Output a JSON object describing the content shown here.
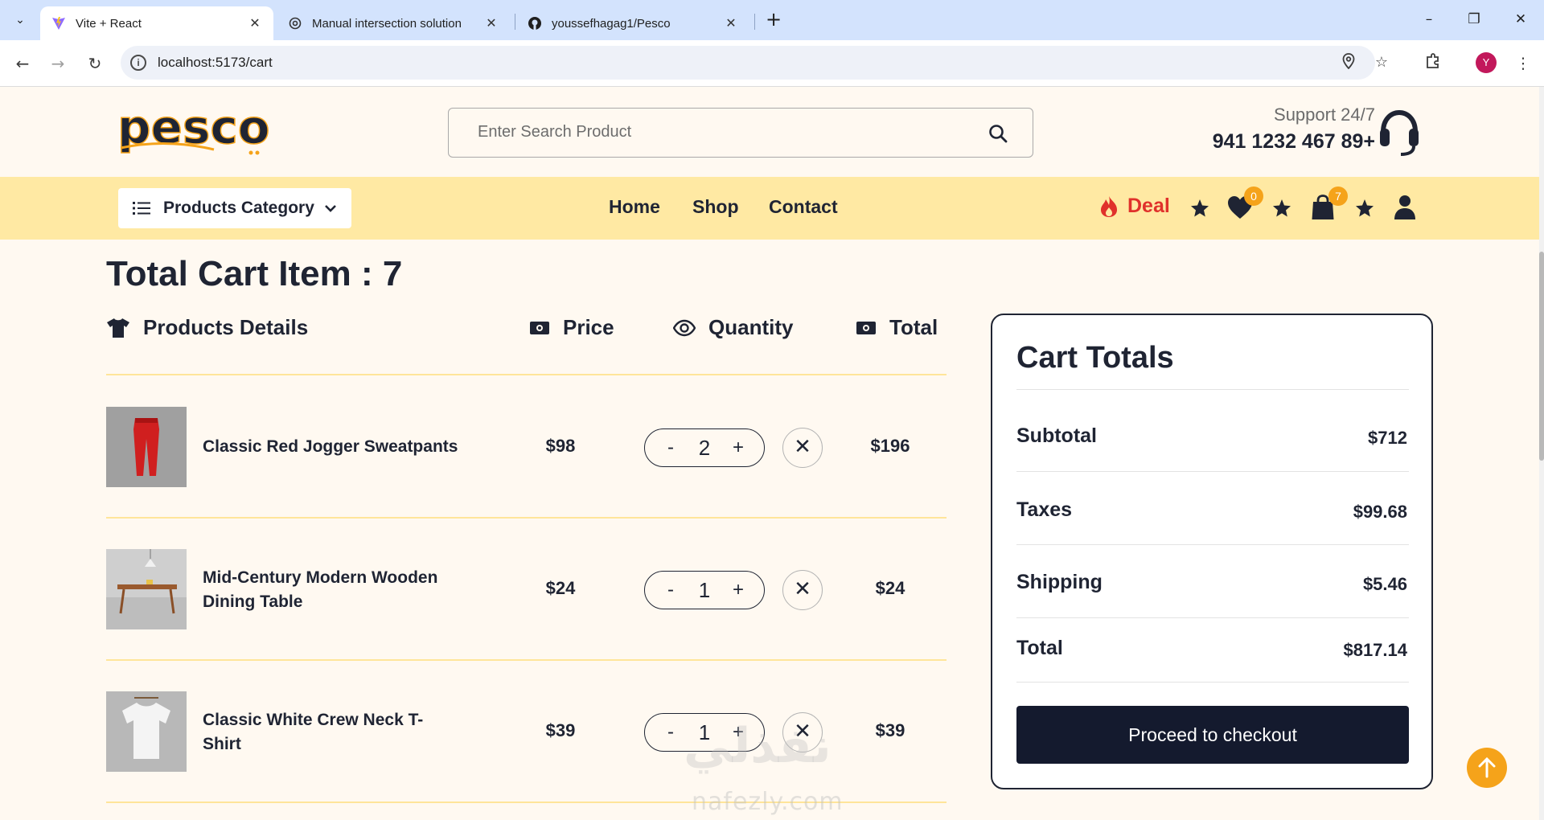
{
  "browser": {
    "tabs": [
      {
        "title": "Vite + React",
        "active": true
      },
      {
        "title": "Manual intersection solution",
        "active": false
      },
      {
        "title": "youssefhagag1/Pesco",
        "active": false
      }
    ],
    "url": "localhost:5173/cart",
    "profile_initial": "Y"
  },
  "header": {
    "logo_text": "pesco",
    "search_placeholder": "Enter Search Product",
    "support_label": "Support 24/7",
    "support_phone": "941 1232 467 89+"
  },
  "navbar": {
    "category_label": "Products Category",
    "links": [
      "Home",
      "Shop",
      "Contact"
    ],
    "deal_label": "Deal",
    "wishlist_count": "0",
    "cart_count": "7"
  },
  "cart": {
    "title": "Total Cart Item : 7",
    "columns": {
      "product": "Products Details",
      "price": "Price",
      "quantity": "Quantity",
      "total": "Total"
    },
    "items": [
      {
        "name": "Classic Red Jogger Sweatpants",
        "price": "$98",
        "qty": "2",
        "total": "$196"
      },
      {
        "name": "Mid-Century Modern Wooden Dining Table",
        "price": "$24",
        "qty": "1",
        "total": "$24"
      },
      {
        "name": "Classic White Crew Neck T-Shirt",
        "price": "$39",
        "qty": "1",
        "total": "$39"
      }
    ],
    "qty_minus": "-",
    "qty_plus": "+"
  },
  "totals": {
    "title": "Cart Totals",
    "subtotal_label": "Subtotal",
    "subtotal": "$712",
    "taxes_label": "Taxes",
    "taxes": "$99.68",
    "shipping_label": "Shipping",
    "shipping": "$5.46",
    "total_label": "Total",
    "total": "$817.14",
    "checkout_label": "Proceed to checkout"
  },
  "watermark": {
    "arabic": "نفذلي",
    "latin": "nafezly.com"
  },
  "colors": {
    "accent": "#f5a31a",
    "navbar_bg": "#ffe9a3",
    "deal_red": "#e0312b",
    "dark": "#141a2e",
    "page_bg": "#fff9f1"
  }
}
